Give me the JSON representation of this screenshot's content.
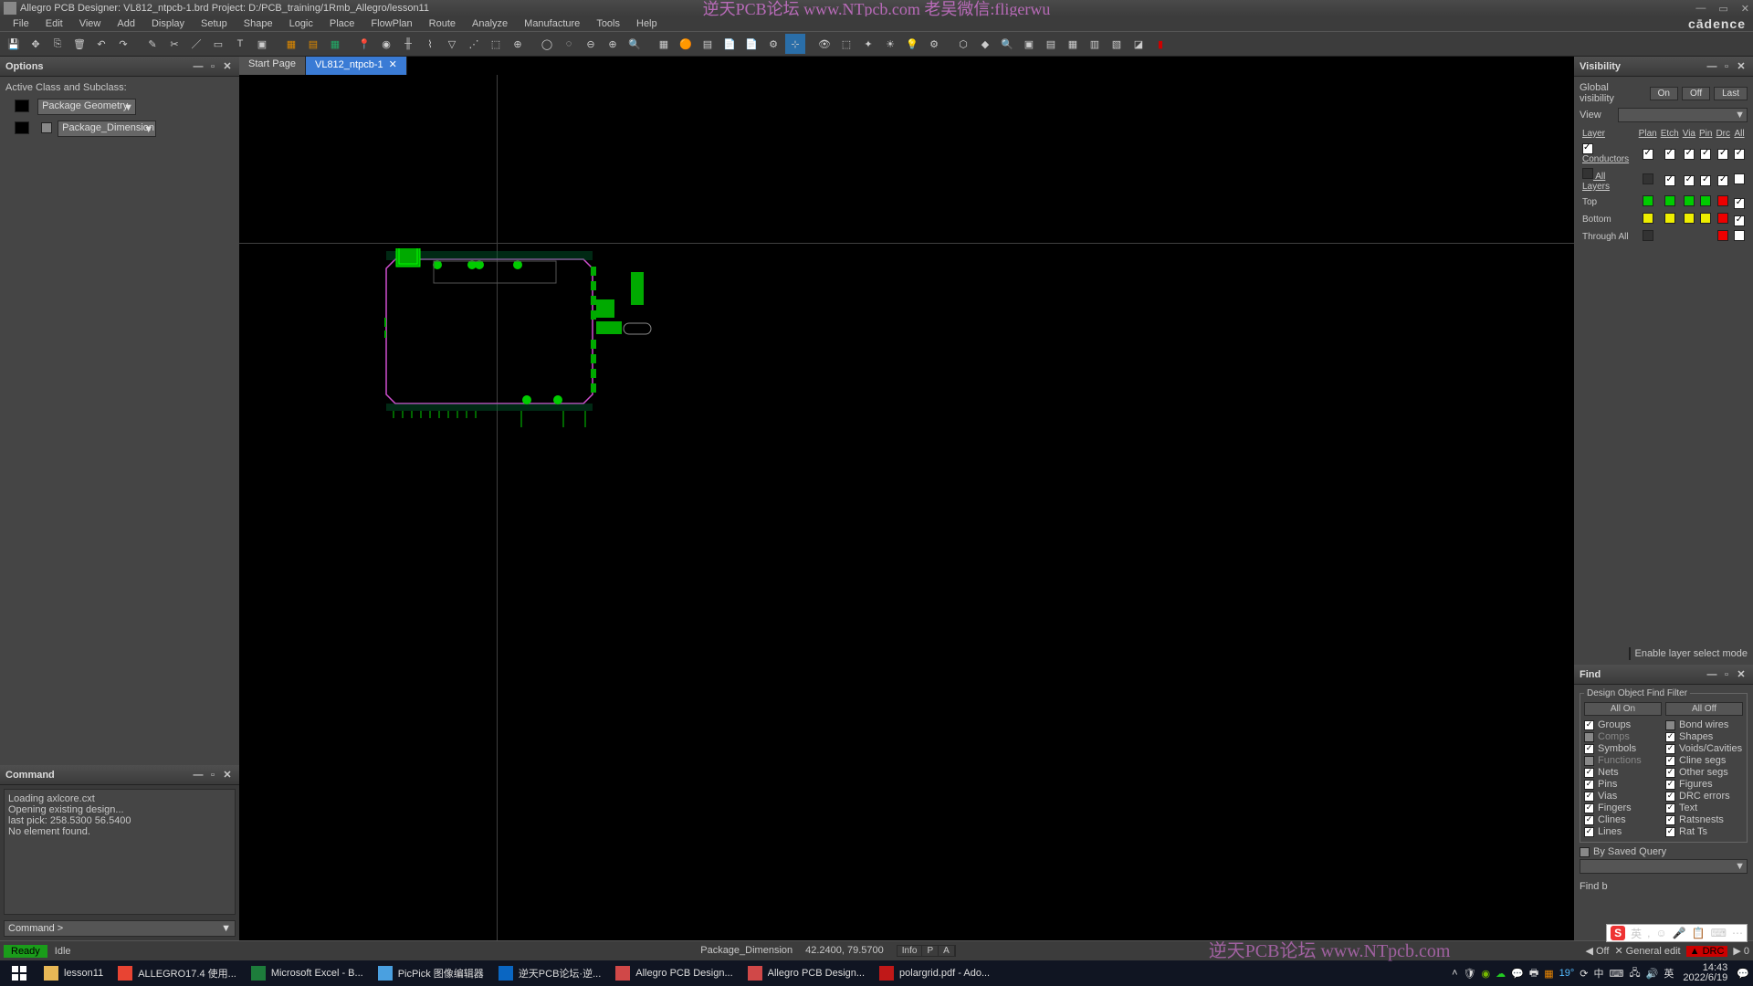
{
  "title": "Allegro PCB Designer: VL812_ntpcb-1.brd   Project: D:/PCB_training/1Rmb_Allegro/lesson11",
  "watermark_top": "逆天PCB论坛 www.NTpcb.com 老吴微信:fligerwu",
  "watermark_bottom": "逆天PCB论坛 www.NTpcb.com",
  "menu": [
    "File",
    "Edit",
    "View",
    "Add",
    "Display",
    "Setup",
    "Shape",
    "Logic",
    "Place",
    "FlowPlan",
    "Route",
    "Analyze",
    "Manufacture",
    "Tools",
    "Help"
  ],
  "brand": "cādence",
  "tabs": {
    "start": "Start Page",
    "active": "VL812_ntpcb-1"
  },
  "options": {
    "title": "Options",
    "class_label": "Active Class and Subclass:",
    "class_value": "Package Geometry",
    "subclass_value": "Package_Dimension"
  },
  "command": {
    "title": "Command",
    "lines": [
      "Loading axlcore.cxt",
      "Opening existing design...",
      "last pick:  258.5300 56.5400",
      "No element found."
    ],
    "prompt": "Command >"
  },
  "visibility": {
    "title": "Visibility",
    "global": "Global visibility",
    "btn_on": "On",
    "btn_off": "Off",
    "btn_last": "Last",
    "view": "View",
    "hdr_layer": "Layer",
    "cols": [
      "Plan",
      "Etch",
      "Via",
      "Pin",
      "Drc",
      "All"
    ],
    "rows": [
      {
        "name": "Conductors",
        "chk": [
          true,
          true,
          true,
          true,
          true,
          true
        ],
        "colors": [
          "white",
          "white",
          "white",
          "white",
          "white",
          "white"
        ]
      },
      {
        "name": "All Layers",
        "chk": [
          false,
          true,
          true,
          true,
          true,
          false
        ],
        "colors": [
          "dark",
          "white",
          "white",
          "white",
          "white",
          "white"
        ]
      },
      {
        "name": "Top",
        "chk": [
          null,
          null,
          null,
          null,
          null,
          true
        ],
        "colors": [
          "green",
          "green",
          "green",
          "green",
          "red",
          "white"
        ]
      },
      {
        "name": "Bottom",
        "chk": [
          null,
          null,
          null,
          null,
          null,
          true
        ],
        "colors": [
          "yellow",
          "yellow",
          "yellow",
          "yellow",
          "red",
          "white"
        ]
      },
      {
        "name": "Through All",
        "chk": [
          null,
          null,
          null,
          null,
          null,
          null
        ],
        "colors": [
          "dark",
          "",
          "",
          "",
          "red",
          "white"
        ]
      }
    ],
    "enable_label": "Enable layer select mode"
  },
  "find": {
    "title": "Find",
    "fieldset": "Design Object Find Filter",
    "all_on": "All On",
    "all_off": "All Off",
    "left": [
      {
        "l": "Groups",
        "on": true
      },
      {
        "l": "Comps",
        "on": false,
        "dim": true
      },
      {
        "l": "Symbols",
        "on": true
      },
      {
        "l": "Functions",
        "on": false,
        "dim": true
      },
      {
        "l": "Nets",
        "on": true
      },
      {
        "l": "Pins",
        "on": true
      },
      {
        "l": "Vias",
        "on": true
      },
      {
        "l": "Fingers",
        "on": true
      },
      {
        "l": "Clines",
        "on": true
      },
      {
        "l": "Lines",
        "on": true
      }
    ],
    "right": [
      {
        "l": "Bond wires",
        "on": false
      },
      {
        "l": "Shapes",
        "on": true
      },
      {
        "l": "Voids/Cavities",
        "on": true
      },
      {
        "l": "Cline segs",
        "on": true
      },
      {
        "l": "Other segs",
        "on": true
      },
      {
        "l": "Figures",
        "on": true
      },
      {
        "l": "DRC errors",
        "on": true
      },
      {
        "l": "Text",
        "on": true
      },
      {
        "l": "Ratsnests",
        "on": true
      },
      {
        "l": "Rat Ts",
        "on": true
      }
    ],
    "saved_label": "By Saved Query",
    "findby_label": "Find b"
  },
  "status": {
    "ready": "Ready",
    "idle": "Idle",
    "layer": "Package_Dimension",
    "coords": "42.2400, 79.5700",
    "mini": [
      "Info",
      "P",
      "A"
    ],
    "off": "Off",
    "mode": "General edit",
    "drc": "DRC",
    "count": "0"
  },
  "taskbar": {
    "items": [
      {
        "label": "lesson11",
        "color": "#e8b856"
      },
      {
        "label": "ALLEGRO17.4 使用...",
        "color": "#e84433"
      },
      {
        "label": "Microsoft Excel - B...",
        "color": "#1d7c3b"
      },
      {
        "label": "PicPick 图像编辑器",
        "color": "#4aa0e0"
      },
      {
        "label": "逆天PCB论坛·逆...",
        "color": "#0a66c2"
      },
      {
        "label": "Allegro PCB Design...",
        "color": "#d04848"
      },
      {
        "label": "Allegro PCB Design...",
        "color": "#d04848"
      },
      {
        "label": "polargrid.pdf - Ado...",
        "color": "#c01818"
      }
    ],
    "temp": "19",
    "lang1": "中",
    "lang2": "英",
    "time": "14:43",
    "date": "2022/6/19"
  },
  "ime": [
    "英",
    ",",
    "☺",
    "🎤",
    "📋",
    "⌨",
    "⋯"
  ]
}
